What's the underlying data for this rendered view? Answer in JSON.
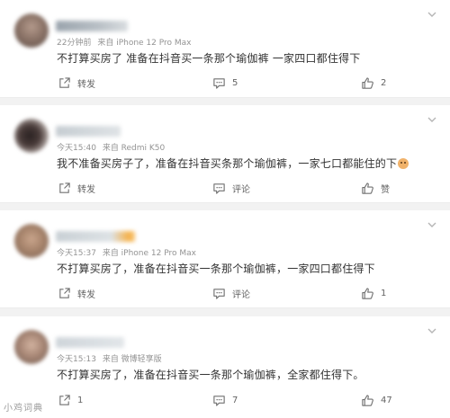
{
  "comments": [
    {
      "time": "22分钟前",
      "source": "来自 iPhone 12 Pro Max",
      "text": "不打算买房了 准备在抖音买一条那个瑜伽裤 一家四口都住得下",
      "has_emoji": false,
      "repost_label": "转发",
      "comment_label": "5",
      "like_label": "2"
    },
    {
      "time": "今天15:40",
      "source": "来自 Redmi K50",
      "text": "我不准备买房子了，准备在抖音买条那个瑜伽裤，一家七口都能住的下",
      "has_emoji": true,
      "repost_label": "转发",
      "comment_label": "评论",
      "like_label": "赞"
    },
    {
      "time": "今天15:37",
      "source": "来自 iPhone 12 Pro Max",
      "text": "不打算买房了，准备在抖音买一条那个瑜伽裤，一家四口都住得下",
      "has_emoji": false,
      "repost_label": "转发",
      "comment_label": "评论",
      "like_label": "1"
    },
    {
      "time": "今天15:13",
      "source": "来自 微博轻享版",
      "text": "不打算买房了，准备在抖音买一条那个瑜伽裤，全家都住得下。",
      "has_emoji": false,
      "repost_label": "1",
      "comment_label": "7",
      "like_label": "47"
    }
  ],
  "watermark": "小鸡词典",
  "icons": {
    "repost": "repost-icon",
    "comment": "comment-icon",
    "like": "like-icon",
    "menu": "chevron-down-icon",
    "emoji": "doge-emoji-icon"
  },
  "colors": {
    "background": "#f2f2f2",
    "card": "#ffffff",
    "meta_text": "#939393",
    "body_text": "#333333",
    "action_text": "#636363",
    "name_highlight": "#f7a623"
  }
}
